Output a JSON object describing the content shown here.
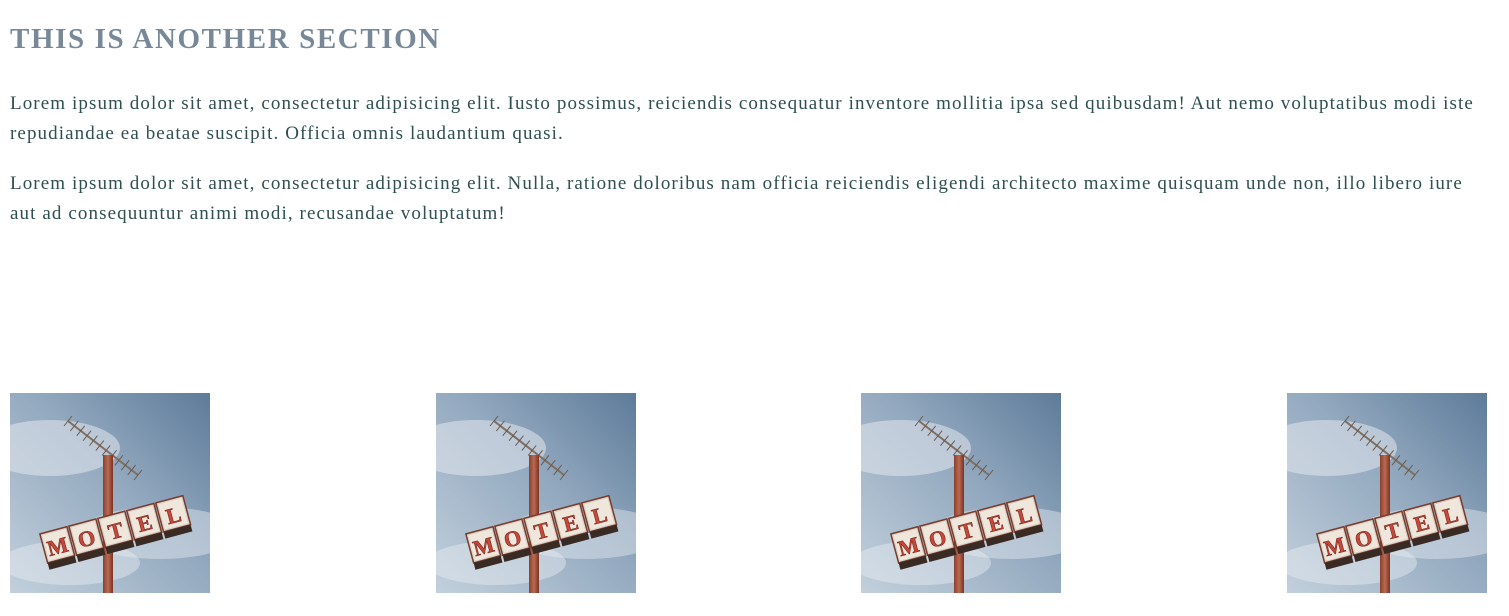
{
  "section": {
    "title": "THIS IS ANOTHER SECTION",
    "paragraphs": [
      "Lorem ipsum dolor sit amet, consectetur adipisicing elit. Iusto possimus, reiciendis consequatur inventore mollitia ipsa sed quibusdam! Aut nemo voluptatibus modi iste repudiandae ea beatae suscipit. Officia omnis laudantium quasi.",
      "Lorem ipsum dolor sit amet, consectetur adipisicing elit. Nulla, ratione doloribus nam officia reiciendis eligendi architecto maxime quisquam unde non, illo libero iure aut ad consequuntur animi modi, recusandae voluptatum!"
    ]
  },
  "gallery": {
    "images": [
      {
        "sign_text": "MOTEL"
      },
      {
        "sign_text": "MOTEL"
      },
      {
        "sign_text": "MOTEL"
      },
      {
        "sign_text": "MOTEL"
      }
    ]
  }
}
